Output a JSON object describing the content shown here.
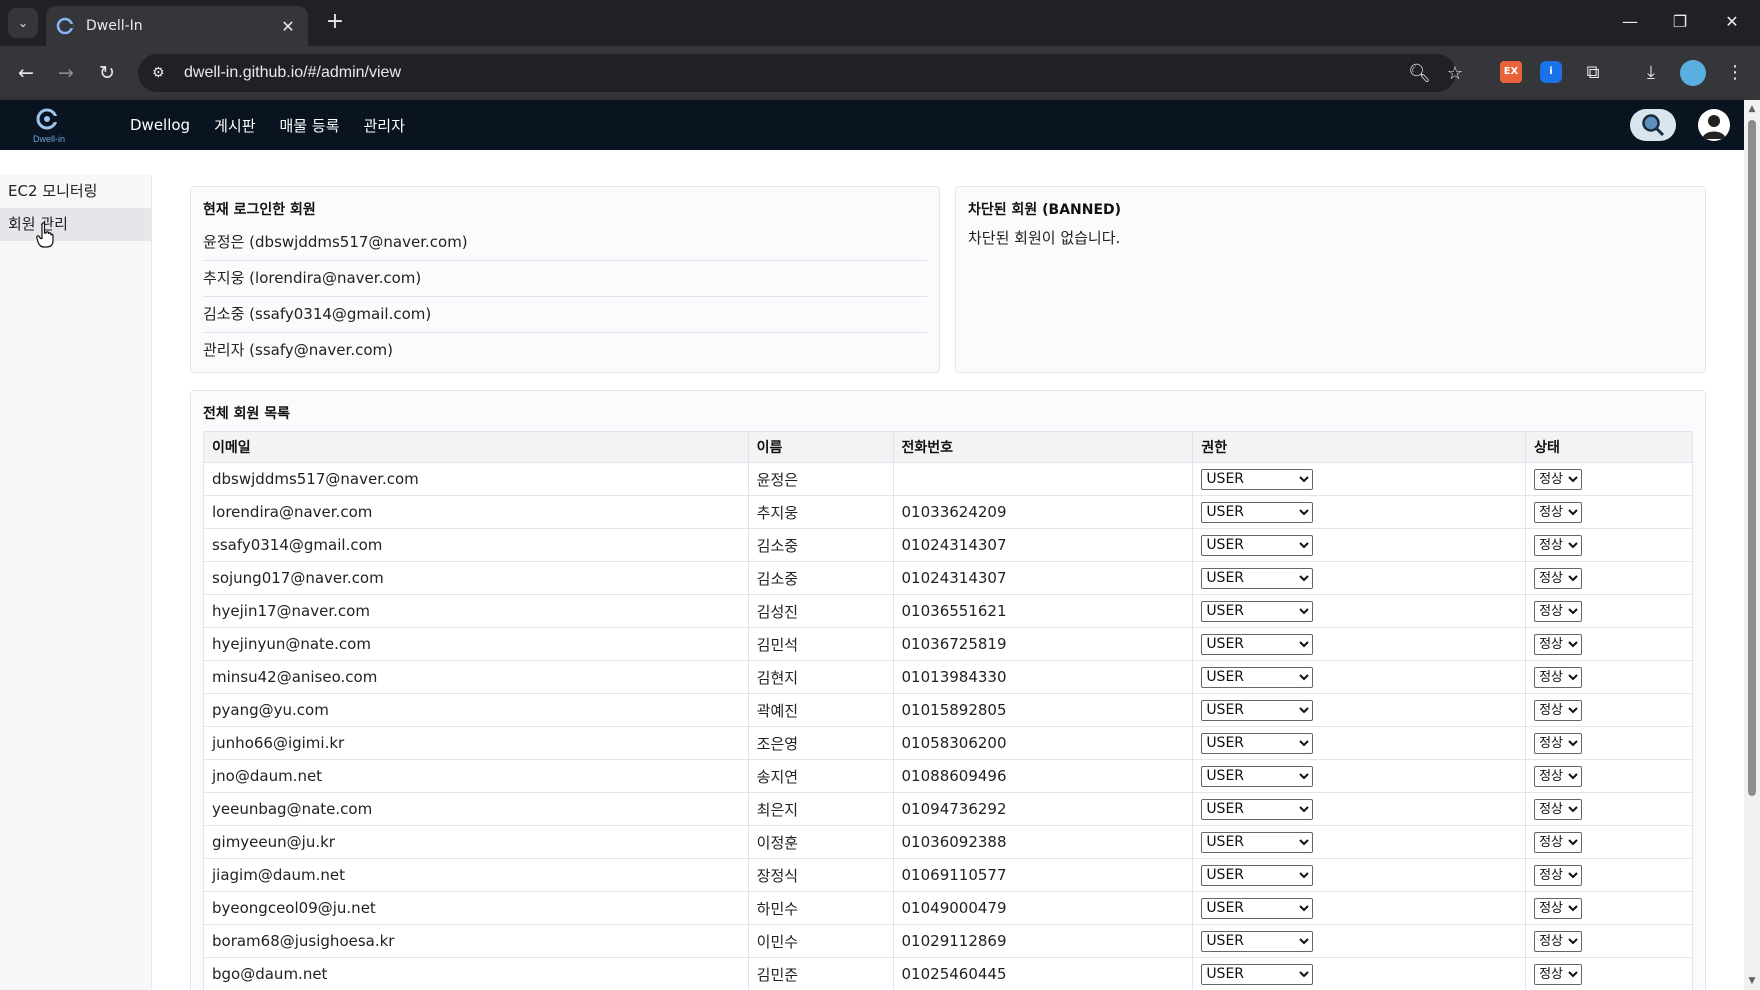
{
  "browser": {
    "tab_title": "Dwell-In",
    "url": "dwell-in.github.io/#/admin/view",
    "tab_close": "✕",
    "new_tab": "+"
  },
  "app": {
    "logo_text": "Dwell-in",
    "menu": [
      "Dwellog",
      "게시판",
      "매물 등록",
      "관리자"
    ]
  },
  "sidebar": {
    "items": [
      {
        "label": "EC2 모니터링",
        "active": false
      },
      {
        "label": "회원 관리",
        "active": true
      }
    ]
  },
  "logged_in": {
    "title": "현재 로그인한 회원",
    "members": [
      "윤정은 (dbswjddms517@naver.com)",
      "추지웅 (lorendira@naver.com)",
      "김소중 (ssafy0314@gmail.com)",
      "관리자 (ssafy@naver.com)"
    ]
  },
  "banned": {
    "title": "차단된 회원 (BANNED)",
    "empty_text": "차단된 회원이 없습니다."
  },
  "members_table": {
    "title": "전체 회원 목록",
    "columns": [
      "이메일",
      "이름",
      "전화번호",
      "권한",
      "상태"
    ],
    "rows": [
      {
        "email": "dbswjddms517@naver.com",
        "name": "윤정은",
        "phone": "",
        "role": "USER",
        "status": "정상"
      },
      {
        "email": "lorendira@naver.com",
        "name": "추지웅",
        "phone": "01033624209",
        "role": "USER",
        "status": "정상"
      },
      {
        "email": "ssafy0314@gmail.com",
        "name": "김소중",
        "phone": "01024314307",
        "role": "USER",
        "status": "정상"
      },
      {
        "email": "sojung017@naver.com",
        "name": "김소중",
        "phone": "01024314307",
        "role": "USER",
        "status": "정상"
      },
      {
        "email": "hyejin17@naver.com",
        "name": "김성진",
        "phone": "01036551621",
        "role": "USER",
        "status": "정상"
      },
      {
        "email": "hyejinyun@nate.com",
        "name": "김민석",
        "phone": "01036725819",
        "role": "USER",
        "status": "정상"
      },
      {
        "email": "minsu42@aniseo.com",
        "name": "김현지",
        "phone": "01013984330",
        "role": "USER",
        "status": "정상"
      },
      {
        "email": "pyang@yu.com",
        "name": "곽예진",
        "phone": "01015892805",
        "role": "USER",
        "status": "정상"
      },
      {
        "email": "junho66@igimi.kr",
        "name": "조은영",
        "phone": "01058306200",
        "role": "USER",
        "status": "정상"
      },
      {
        "email": "jno@daum.net",
        "name": "송지연",
        "phone": "01088609496",
        "role": "USER",
        "status": "정상"
      },
      {
        "email": "yeeunbag@nate.com",
        "name": "최은지",
        "phone": "01094736292",
        "role": "USER",
        "status": "정상"
      },
      {
        "email": "gimyeeun@ju.kr",
        "name": "이정훈",
        "phone": "01036092388",
        "role": "USER",
        "status": "정상"
      },
      {
        "email": "jiagim@daum.net",
        "name": "장정식",
        "phone": "01069110577",
        "role": "USER",
        "status": "정상"
      },
      {
        "email": "byeongceol09@ju.net",
        "name": "하민수",
        "phone": "01049000479",
        "role": "USER",
        "status": "정상"
      },
      {
        "email": "boram68@jusighoesa.kr",
        "name": "이민수",
        "phone": "01029112869",
        "role": "USER",
        "status": "정상"
      },
      {
        "email": "bgo@daum.net",
        "name": "김민준",
        "phone": "01025460445",
        "role": "USER",
        "status": "정상"
      }
    ]
  },
  "icons": {
    "back": "back-arrow-icon",
    "forward": "forward-arrow-icon",
    "reload": "reload-icon",
    "site_info": "site-info-icon",
    "zoom": "zoom-icon",
    "bookmark": "star-icon",
    "extensions": "puzzle-icon",
    "download": "download-icon",
    "menu": "kebab-menu-icon",
    "search": "search-icon",
    "profile": "user-icon"
  },
  "colors": {
    "header_bg": "#0a1420",
    "chrome_dark": "#202124",
    "chrome_toolbar": "#35363a"
  }
}
